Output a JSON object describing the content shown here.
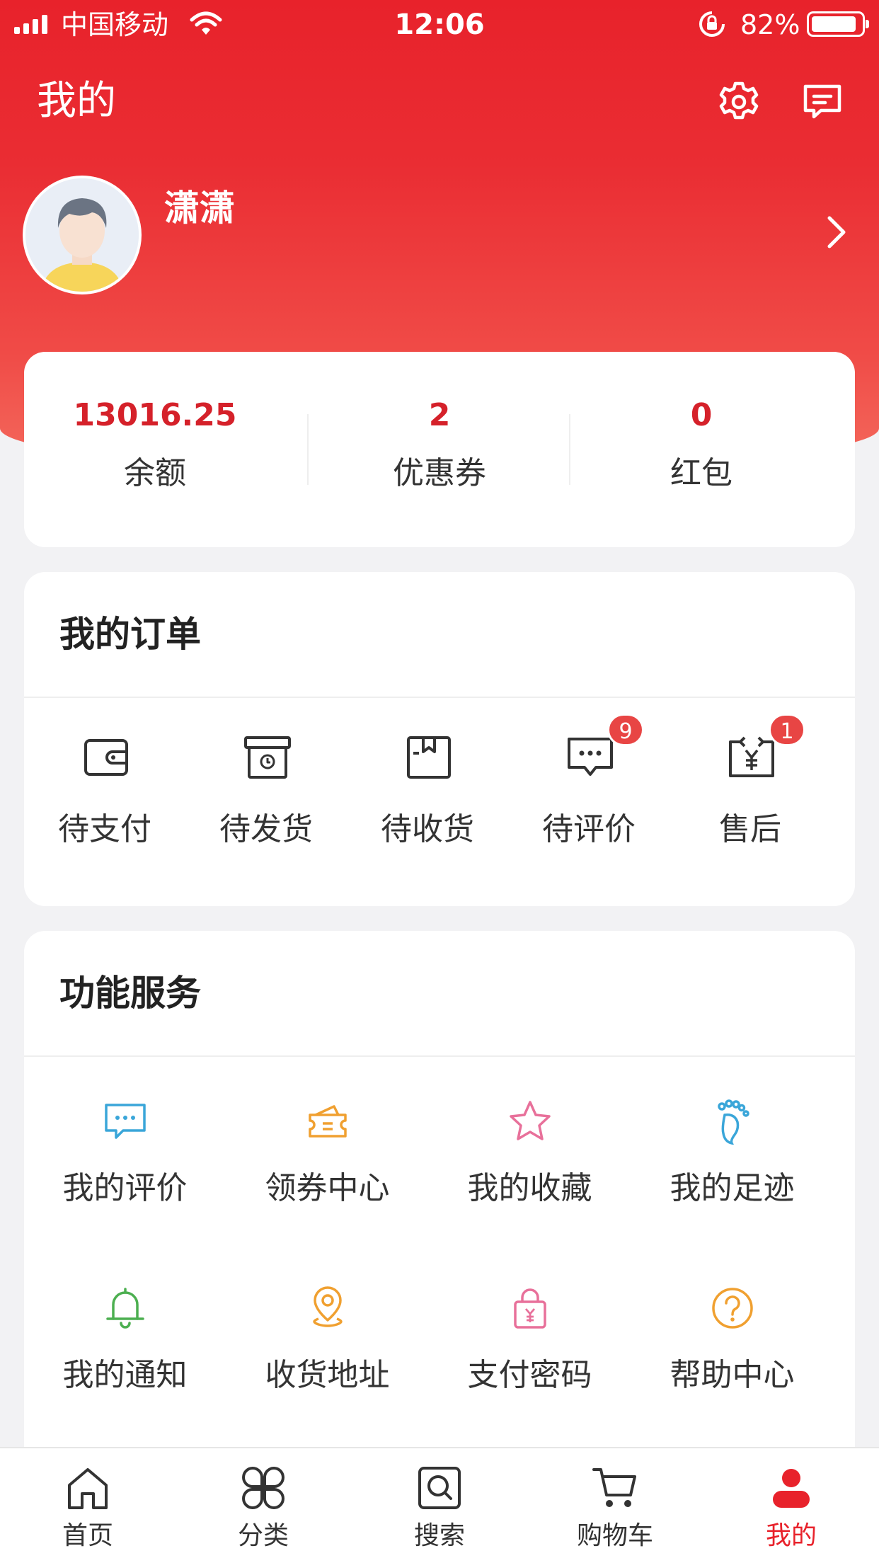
{
  "status_bar": {
    "carrier": "中国移动",
    "time": "12:06",
    "battery_percent": "82%"
  },
  "header": {
    "title": "我的",
    "settings_icon": "gear-icon",
    "messages_icon": "message-icon"
  },
  "profile": {
    "name": "潇潇"
  },
  "wallet": {
    "items": [
      {
        "value": "13016.25",
        "label": "余额"
      },
      {
        "value": "2",
        "label": "优惠券"
      },
      {
        "value": "0",
        "label": "红包"
      }
    ],
    "value_color": "#d5212a"
  },
  "orders": {
    "title": "我的订单",
    "items": [
      {
        "label": "待支付",
        "icon": "wallet-icon",
        "badge": ""
      },
      {
        "label": "待发货",
        "icon": "box-clock-icon",
        "badge": ""
      },
      {
        "label": "待收货",
        "icon": "package-icon",
        "badge": ""
      },
      {
        "label": "待评价",
        "icon": "chat-bubble-icon",
        "badge": "9"
      },
      {
        "label": "售后",
        "icon": "refund-icon",
        "badge": "1"
      }
    ]
  },
  "services": {
    "title": "功能服务",
    "items": [
      {
        "label": "我的评价",
        "icon": "comment-icon",
        "color": "#3aa6d9"
      },
      {
        "label": "领券中心",
        "icon": "coupon-icon",
        "color": "#f0a030"
      },
      {
        "label": "我的收藏",
        "icon": "star-icon",
        "color": "#e8709a"
      },
      {
        "label": "我的足迹",
        "icon": "footprint-icon",
        "color": "#3aa6d9"
      },
      {
        "label": "我的通知",
        "icon": "bell-icon",
        "color": "#4caf50"
      },
      {
        "label": "收货地址",
        "icon": "location-icon",
        "color": "#f0a030"
      },
      {
        "label": "支付密码",
        "icon": "lock-icon",
        "color": "#e8709a"
      },
      {
        "label": "帮助中心",
        "icon": "help-icon",
        "color": "#f0a030"
      }
    ]
  },
  "tabbar": {
    "items": [
      {
        "label": "首页",
        "icon": "home-icon"
      },
      {
        "label": "分类",
        "icon": "category-icon"
      },
      {
        "label": "搜索",
        "icon": "search-icon"
      },
      {
        "label": "购物车",
        "icon": "cart-icon"
      },
      {
        "label": "我的",
        "icon": "profile-icon",
        "active": true
      }
    ],
    "active_color": "#e8222b"
  }
}
